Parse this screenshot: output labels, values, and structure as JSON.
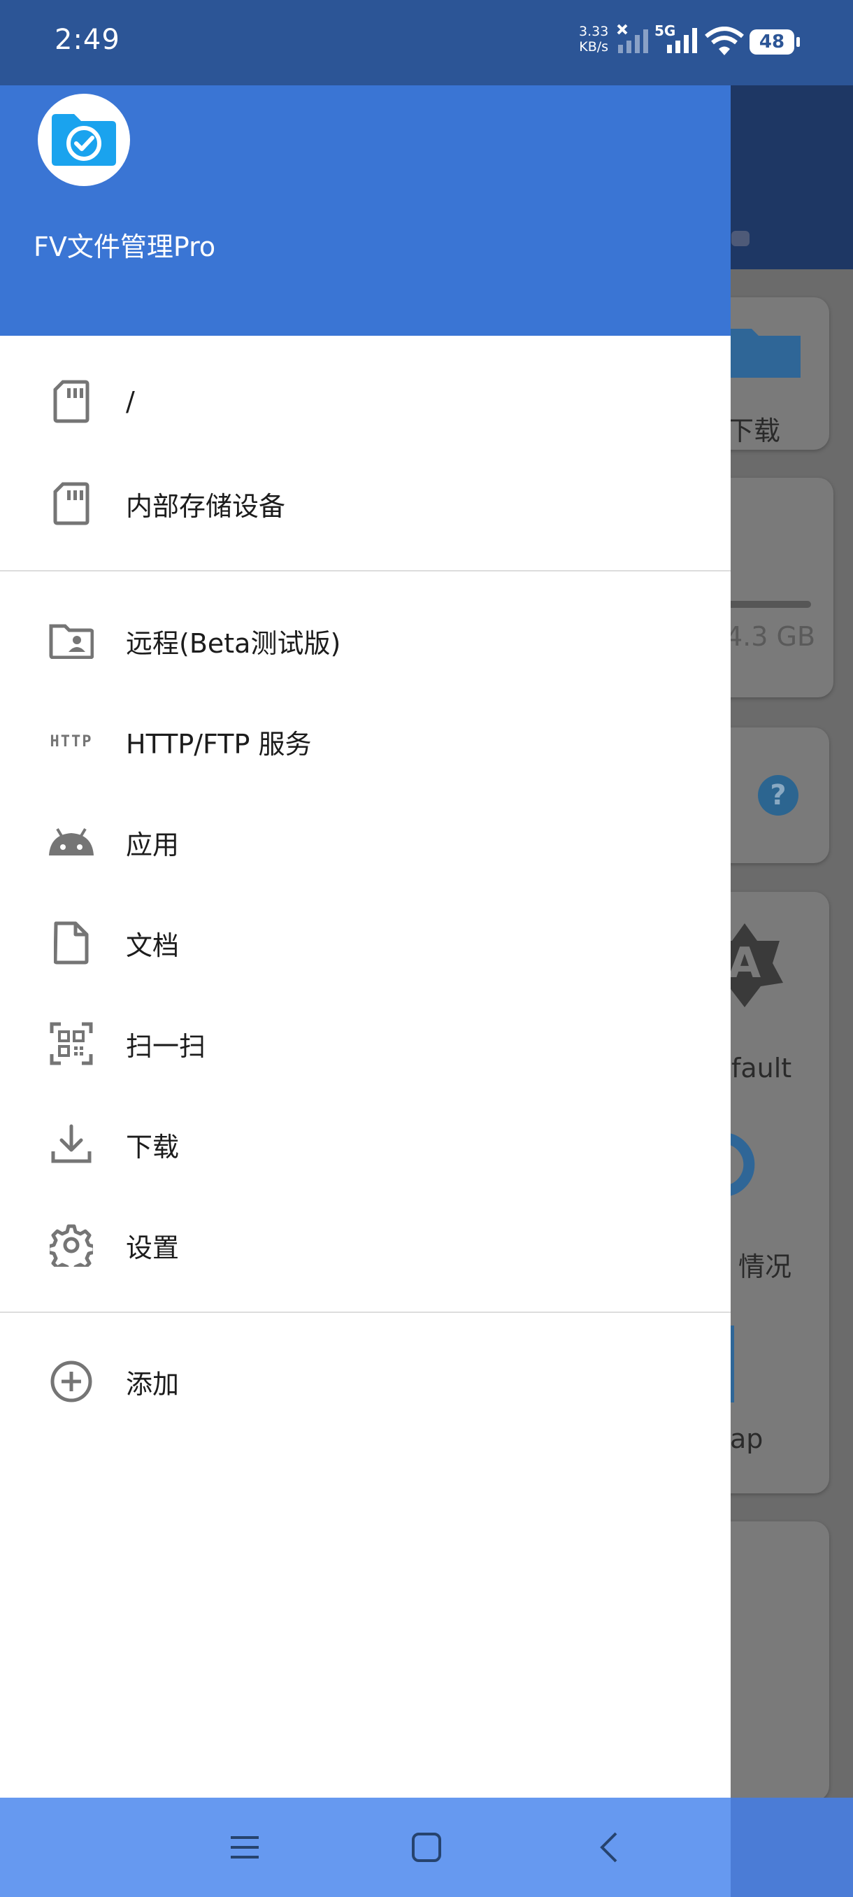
{
  "status_bar": {
    "time": "2:49",
    "net_rate_value": "3.33",
    "net_rate_unit": "KB/s",
    "network_type": "5G",
    "battery": "48"
  },
  "drawer": {
    "app_name": "FV文件管理Pro",
    "storage_items": [
      {
        "label": "/",
        "icon": "sd-card-icon"
      },
      {
        "label": "内部存储设备",
        "icon": "sd-card-icon"
      }
    ],
    "menu_items": [
      {
        "label": "远程(Beta测试版)",
        "icon": "remote-folder-icon"
      },
      {
        "label": "HTTP/FTP 服务",
        "icon": "http-icon"
      },
      {
        "label": "应用",
        "icon": "android-icon"
      },
      {
        "label": "文档",
        "icon": "document-icon"
      },
      {
        "label": "扫一扫",
        "icon": "qr-scan-icon"
      },
      {
        "label": "下载",
        "icon": "download-icon"
      },
      {
        "label": "设置",
        "icon": "gear-icon"
      }
    ],
    "add_item": {
      "label": "添加",
      "icon": "add-circle-icon"
    },
    "http_icon_text": "HTTP"
  },
  "background": {
    "card_download_label": "下载",
    "storage_size": "4.3 GB",
    "theme_label": "fault",
    "usage_label": "情况",
    "app_label": "ap",
    "theme_badge": "A"
  },
  "colors": {
    "status_bar": "#2c5596",
    "drawer_header": "#3a75d4",
    "nav_bar": "#6699f0",
    "icon_grey": "#757575"
  }
}
